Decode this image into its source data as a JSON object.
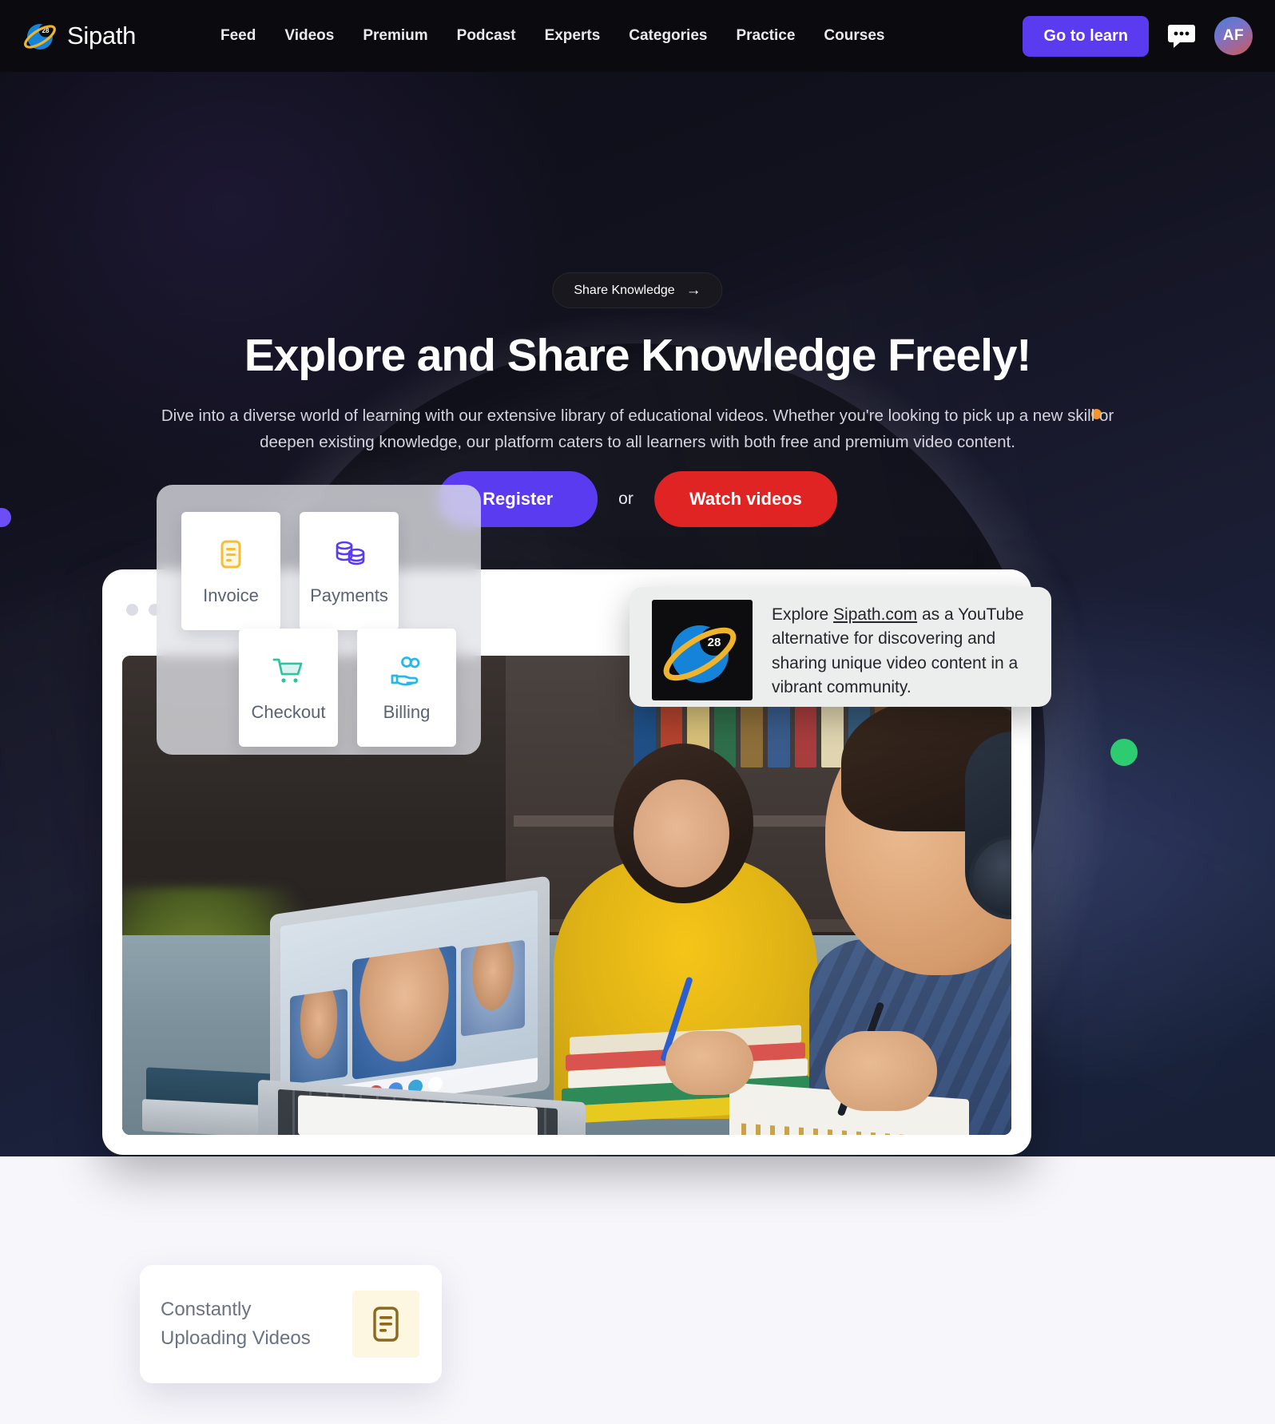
{
  "brand": {
    "name": "Sipath",
    "badge": "28"
  },
  "nav": {
    "links": [
      {
        "label": "Feed"
      },
      {
        "label": "Videos"
      },
      {
        "label": "Premium"
      },
      {
        "label": "Podcast"
      },
      {
        "label": "Experts"
      },
      {
        "label": "Categories"
      },
      {
        "label": "Practice"
      },
      {
        "label": "Courses"
      }
    ],
    "cta_label": "Go to learn",
    "chat_icon": "chat-bubble-icon",
    "avatar_initials": "AF"
  },
  "hero": {
    "pill_label": "Share Knowledge",
    "pill_arrow": "→",
    "title": "Explore and Share Knowledge Freely!",
    "subtitle": "Dive into a diverse world of learning with our extensive library of educational videos. Whether you're looking to pick up a new skill or deepen existing knowledge, our platform caters to all learners with both free and premium video content.",
    "register_label": "Register",
    "or_label": "or",
    "watch_label": "Watch videos"
  },
  "widget": {
    "tiles": [
      {
        "label": "Invoice",
        "icon": "invoice-document-icon",
        "color": "#f5bd38"
      },
      {
        "label": "Payments",
        "icon": "coin-stack-icon",
        "color": "#5b3bf0"
      },
      {
        "label": "Checkout",
        "icon": "shopping-cart-icon",
        "color": "#2ec4a0"
      },
      {
        "label": "Billing",
        "icon": "hand-coins-icon",
        "color": "#25b8e8"
      }
    ]
  },
  "tooltip": {
    "thumb_icon": "sipath-planet-logo",
    "text_before": "Explore ",
    "link": "Sipath.com",
    "text_after": " as a YouTube alternative for discovering and sharing unique video content in a vibrant community."
  },
  "upload_card": {
    "line1": "Constantly",
    "line2": "Uploading Videos",
    "icon": "document-lines-icon"
  },
  "decor": {
    "dot_purple": "#6c4df6",
    "dot_orange": "#f0942b",
    "dot_green": "#2ecc71"
  },
  "colors": {
    "accent_purple": "#5b3bf0",
    "accent_red": "#e02424",
    "nav_bg": "#0b0b0f",
    "page_bg": "#f7f6fb"
  }
}
